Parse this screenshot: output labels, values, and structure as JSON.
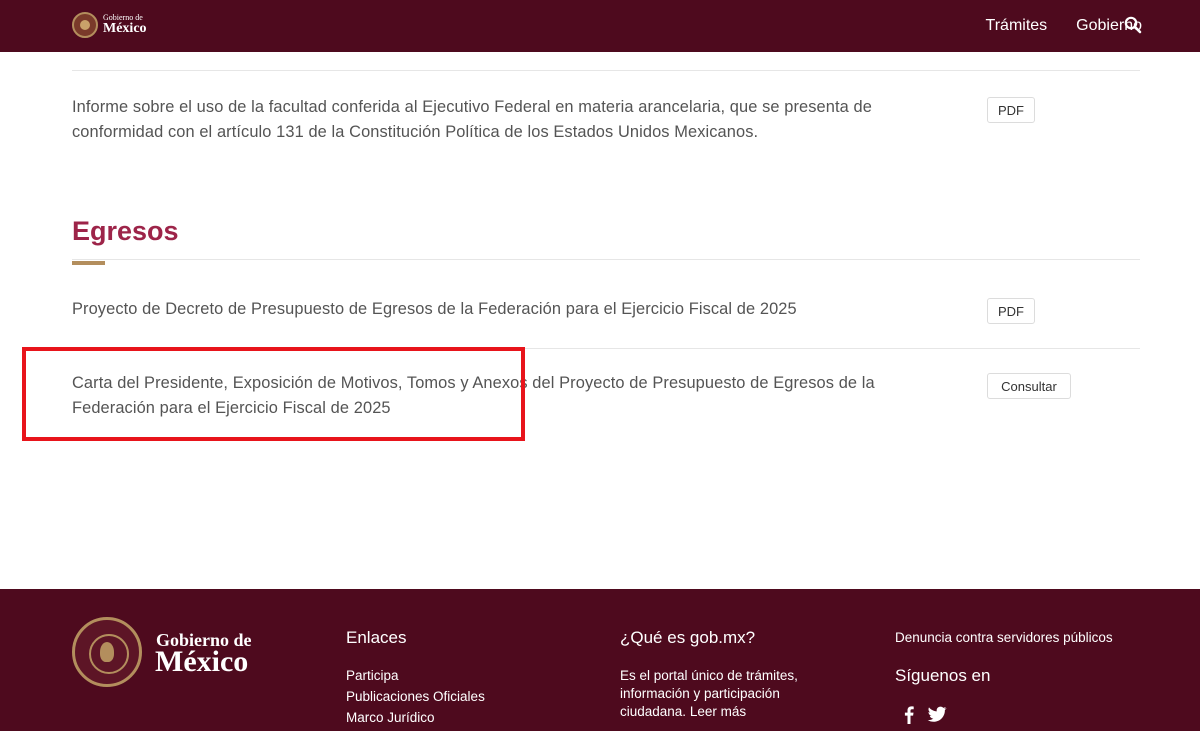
{
  "header": {
    "logo_small": "Gobierno de",
    "logo_big": "México",
    "nav": [
      {
        "label": "Trámites"
      },
      {
        "label": "Gobierno"
      }
    ]
  },
  "rows": {
    "informe": {
      "text": "Informe sobre el uso de la facultad conferida al Ejecutivo Federal en materia arancelaria, que se presenta de conformidad con el artículo 131 de la Constitución Política de los Estados Unidos Mexicanos.",
      "button": "PDF"
    },
    "decreto": {
      "text": "Proyecto de Decreto de Presupuesto de Egresos de la Federación para el Ejercicio Fiscal de 2025",
      "button": "PDF"
    },
    "carta": {
      "text": "Carta del Presidente, Exposición de Motivos, Tomos y Anexos del Proyecto de Presupuesto de Egresos de la Federación para el Ejercicio Fiscal de 2025",
      "button": "Consultar"
    }
  },
  "section": {
    "title": "Egresos"
  },
  "footer": {
    "brand_small": "Gobierno de",
    "brand_big": "México",
    "enlaces": {
      "heading": "Enlaces",
      "links": [
        "Participa",
        "Publicaciones Oficiales",
        "Marco Jurídico"
      ]
    },
    "que_es": {
      "heading": "¿Qué es gob.mx?",
      "text": "Es el portal único de trámites, información y participación ciudadana.",
      "link": "Leer más"
    },
    "denuncia": "Denuncia contra servidores públicos",
    "siguenos": "Síguenos en"
  },
  "colors": {
    "brand_dark": "#4e0a1e",
    "title": "#9d2449",
    "accent": "#b38e5d",
    "highlight": "#e8141b"
  },
  "icons": {
    "search": "search-icon",
    "facebook": "facebook-icon",
    "twitter": "twitter-icon"
  }
}
